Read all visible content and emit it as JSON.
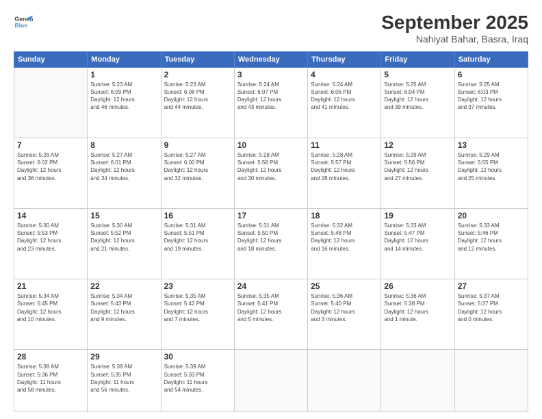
{
  "header": {
    "logo_line1": "General",
    "logo_line2": "Blue",
    "month": "September 2025",
    "location": "Nahiyat Bahar, Basra, Iraq"
  },
  "weekdays": [
    "Sunday",
    "Monday",
    "Tuesday",
    "Wednesday",
    "Thursday",
    "Friday",
    "Saturday"
  ],
  "weeks": [
    [
      {
        "day": "",
        "info": ""
      },
      {
        "day": "1",
        "info": "Sunrise: 5:23 AM\nSunset: 6:09 PM\nDaylight: 12 hours\nand 46 minutes."
      },
      {
        "day": "2",
        "info": "Sunrise: 5:23 AM\nSunset: 6:08 PM\nDaylight: 12 hours\nand 44 minutes."
      },
      {
        "day": "3",
        "info": "Sunrise: 5:24 AM\nSunset: 6:07 PM\nDaylight: 12 hours\nand 43 minutes."
      },
      {
        "day": "4",
        "info": "Sunrise: 5:24 AM\nSunset: 6:06 PM\nDaylight: 12 hours\nand 41 minutes."
      },
      {
        "day": "5",
        "info": "Sunrise: 5:25 AM\nSunset: 6:04 PM\nDaylight: 12 hours\nand 39 minutes."
      },
      {
        "day": "6",
        "info": "Sunrise: 5:25 AM\nSunset: 6:03 PM\nDaylight: 12 hours\nand 37 minutes."
      }
    ],
    [
      {
        "day": "7",
        "info": "Sunrise: 5:26 AM\nSunset: 6:02 PM\nDaylight: 12 hours\nand 36 minutes."
      },
      {
        "day": "8",
        "info": "Sunrise: 5:27 AM\nSunset: 6:01 PM\nDaylight: 12 hours\nand 34 minutes."
      },
      {
        "day": "9",
        "info": "Sunrise: 5:27 AM\nSunset: 6:00 PM\nDaylight: 12 hours\nand 32 minutes."
      },
      {
        "day": "10",
        "info": "Sunrise: 5:28 AM\nSunset: 5:58 PM\nDaylight: 12 hours\nand 30 minutes."
      },
      {
        "day": "11",
        "info": "Sunrise: 5:28 AM\nSunset: 5:57 PM\nDaylight: 12 hours\nand 28 minutes."
      },
      {
        "day": "12",
        "info": "Sunrise: 5:29 AM\nSunset: 5:56 PM\nDaylight: 12 hours\nand 27 minutes."
      },
      {
        "day": "13",
        "info": "Sunrise: 5:29 AM\nSunset: 5:55 PM\nDaylight: 12 hours\nand 25 minutes."
      }
    ],
    [
      {
        "day": "14",
        "info": "Sunrise: 5:30 AM\nSunset: 5:53 PM\nDaylight: 12 hours\nand 23 minutes."
      },
      {
        "day": "15",
        "info": "Sunrise: 5:30 AM\nSunset: 5:52 PM\nDaylight: 12 hours\nand 21 minutes."
      },
      {
        "day": "16",
        "info": "Sunrise: 5:31 AM\nSunset: 5:51 PM\nDaylight: 12 hours\nand 19 minutes."
      },
      {
        "day": "17",
        "info": "Sunrise: 5:31 AM\nSunset: 5:50 PM\nDaylight: 12 hours\nand 18 minutes."
      },
      {
        "day": "18",
        "info": "Sunrise: 5:32 AM\nSunset: 5:48 PM\nDaylight: 12 hours\nand 16 minutes."
      },
      {
        "day": "19",
        "info": "Sunrise: 5:33 AM\nSunset: 5:47 PM\nDaylight: 12 hours\nand 14 minutes."
      },
      {
        "day": "20",
        "info": "Sunrise: 5:33 AM\nSunset: 5:46 PM\nDaylight: 12 hours\nand 12 minutes."
      }
    ],
    [
      {
        "day": "21",
        "info": "Sunrise: 5:34 AM\nSunset: 5:45 PM\nDaylight: 12 hours\nand 10 minutes."
      },
      {
        "day": "22",
        "info": "Sunrise: 5:34 AM\nSunset: 5:43 PM\nDaylight: 12 hours\nand 9 minutes."
      },
      {
        "day": "23",
        "info": "Sunrise: 5:35 AM\nSunset: 5:42 PM\nDaylight: 12 hours\nand 7 minutes."
      },
      {
        "day": "24",
        "info": "Sunrise: 5:35 AM\nSunset: 5:41 PM\nDaylight: 12 hours\nand 5 minutes."
      },
      {
        "day": "25",
        "info": "Sunrise: 5:36 AM\nSunset: 5:40 PM\nDaylight: 12 hours\nand 3 minutes."
      },
      {
        "day": "26",
        "info": "Sunrise: 5:36 AM\nSunset: 5:38 PM\nDaylight: 12 hours\nand 1 minute."
      },
      {
        "day": "27",
        "info": "Sunrise: 5:37 AM\nSunset: 5:37 PM\nDaylight: 12 hours\nand 0 minutes."
      }
    ],
    [
      {
        "day": "28",
        "info": "Sunrise: 5:38 AM\nSunset: 5:36 PM\nDaylight: 11 hours\nand 58 minutes."
      },
      {
        "day": "29",
        "info": "Sunrise: 5:38 AM\nSunset: 5:35 PM\nDaylight: 11 hours\nand 56 minutes."
      },
      {
        "day": "30",
        "info": "Sunrise: 5:39 AM\nSunset: 5:33 PM\nDaylight: 11 hours\nand 54 minutes."
      },
      {
        "day": "",
        "info": ""
      },
      {
        "day": "",
        "info": ""
      },
      {
        "day": "",
        "info": ""
      },
      {
        "day": "",
        "info": ""
      }
    ]
  ]
}
